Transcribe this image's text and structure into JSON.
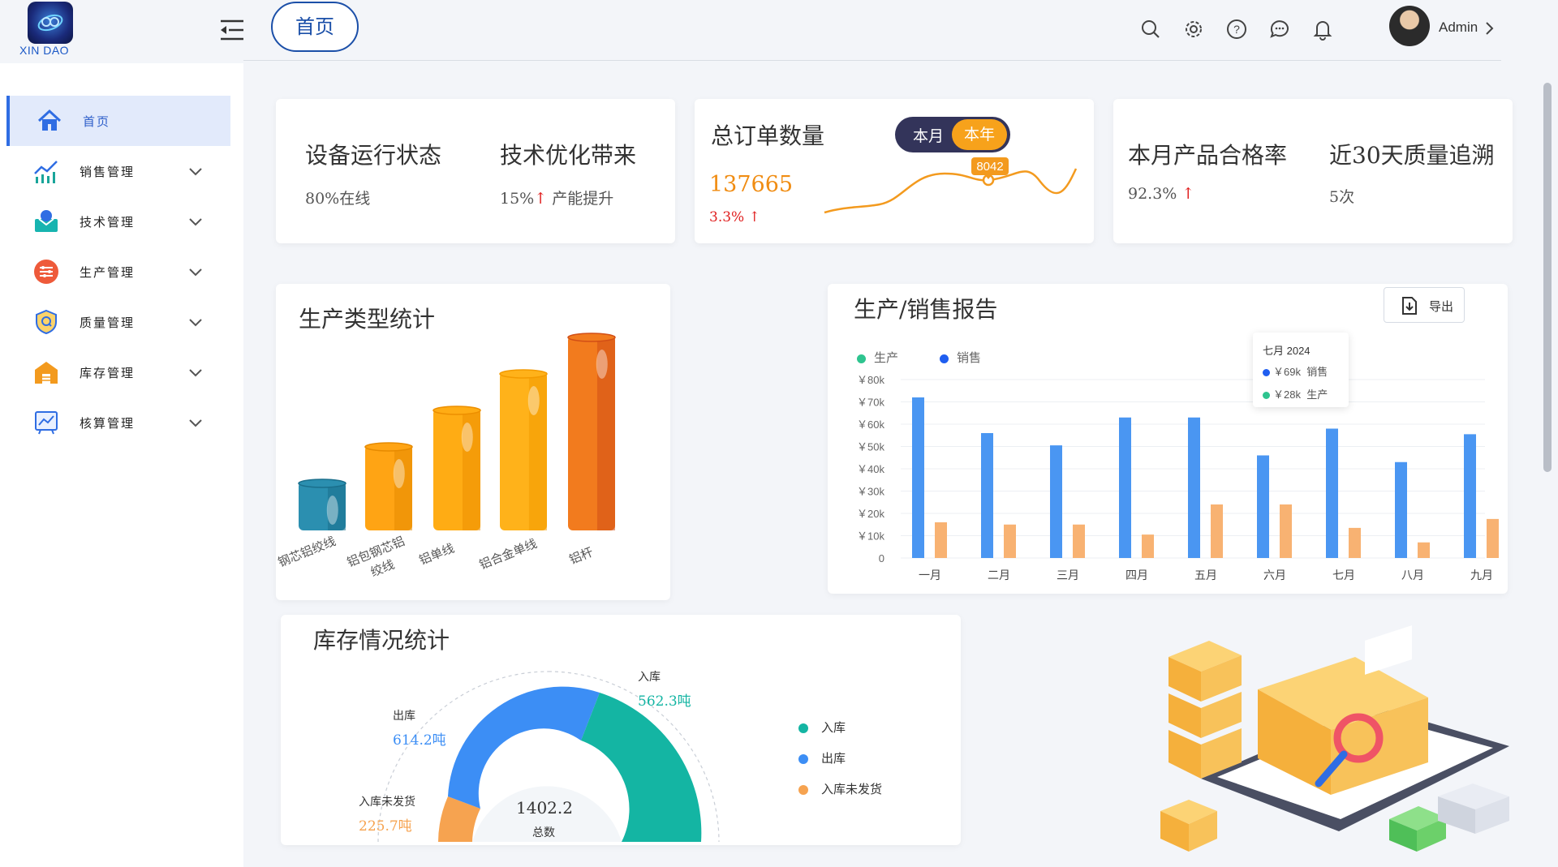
{
  "header": {
    "logo_text": "XIN DAO",
    "home_tab": "首页",
    "user_name": "Admin",
    "icons": [
      "search-icon",
      "settings-icon",
      "help-icon",
      "message-icon",
      "bell-icon"
    ]
  },
  "sidebar": {
    "items": [
      {
        "label": "首页",
        "icon": "home-icon",
        "active": true
      },
      {
        "label": "销售管理",
        "icon": "sales-chart-icon"
      },
      {
        "label": "技术管理",
        "icon": "tech-box-icon"
      },
      {
        "label": "生产管理",
        "icon": "production-sliders-icon"
      },
      {
        "label": "质量管理",
        "icon": "quality-shield-icon"
      },
      {
        "label": "库存管理",
        "icon": "warehouse-icon"
      },
      {
        "label": "核算管理",
        "icon": "accounting-board-icon"
      }
    ]
  },
  "stats": {
    "device_status": {
      "title": "设备运行状态",
      "value": "80%在线"
    },
    "tech_opt": {
      "title": "技术优化带来",
      "value": "15%",
      "arrow": "↑",
      "suffix": "产能提升"
    },
    "orders": {
      "title": "总订单数量",
      "toggle": [
        "本月",
        "本年"
      ],
      "total": "137665",
      "change": "3.3%",
      "arrow": "↑",
      "marker": "8042"
    },
    "pass_rate": {
      "title": "本月产品合格率",
      "value": "92.3%",
      "arrow": "↑"
    },
    "trace": {
      "title": "近30天质量追溯",
      "value": "5次"
    }
  },
  "production_types": {
    "title": "生产类型统计",
    "categories": [
      "钢芯铝绞线",
      "铝包钢芯铝绞线",
      "铝单线",
      "铝合金单线",
      "铝杆"
    ],
    "values": [
      2,
      3.5,
      5,
      6.5,
      8
    ]
  },
  "report": {
    "title": "生产/销售报告",
    "export_label": "导出",
    "tooltip": {
      "title": "七月 2024",
      "rows": [
        {
          "text": "￥69k",
          "name": "销售"
        },
        {
          "text": "￥28k",
          "name": "生产"
        }
      ]
    }
  },
  "chart_data": {
    "type": "bar",
    "categories": [
      "一月",
      "二月",
      "三月",
      "四月",
      "五月",
      "六月",
      "七月",
      "八月",
      "九月"
    ],
    "series": [
      {
        "name": "生产",
        "values": [
          16,
          15,
          15,
          10.5,
          24,
          24,
          13.5,
          7,
          17.5
        ]
      },
      {
        "name": "销售",
        "values": [
          72,
          56,
          50.5,
          63,
          63,
          46,
          58,
          43,
          55.5
        ]
      }
    ],
    "yticks": [
      "0",
      "￥10k",
      "￥20k",
      "￥30k",
      "￥40k",
      "￥50k",
      "￥60k",
      "￥70k",
      "￥80k"
    ],
    "ylim": [
      0,
      80
    ],
    "legend_position": "top-left",
    "grid": true
  },
  "inventory": {
    "title": "库存情况统计",
    "total": "1402.2",
    "total_label": "总数",
    "segments": [
      {
        "name": "入库",
        "value": "562.3吨",
        "color": "#14b5a3"
      },
      {
        "name": "出库",
        "value": "614.2吨",
        "color": "#3c8ef5"
      },
      {
        "name": "入库未发货",
        "value": "225.7吨",
        "color": "#f6a350"
      }
    ]
  },
  "colors": {
    "accent": "#2f6de3",
    "orange": "#f7a21b",
    "teal": "#14b5a3",
    "blue": "#3c8ef5"
  }
}
